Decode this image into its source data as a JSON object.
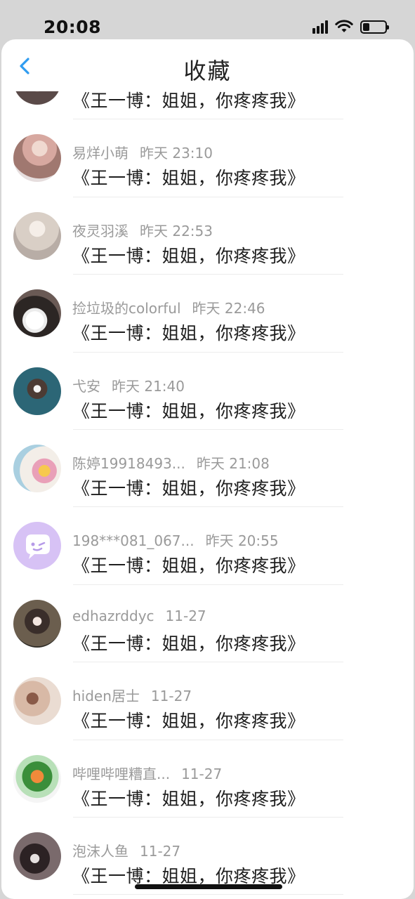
{
  "status_bar": {
    "time": "20:08"
  },
  "header": {
    "title": "收藏",
    "back_icon": "chevron-left-icon"
  },
  "colors": {
    "accent": "#2f9cf0",
    "text_primary": "#1f1f1f",
    "text_secondary": "#9a9a9a"
  },
  "items": [
    {
      "name": "",
      "time": "",
      "message": "《王一博：姐姐，你疼疼我》",
      "avatar": "avatar-photo"
    },
    {
      "name": "易烊小萌",
      "time": "昨天 23:10",
      "message": "《王一博：姐姐，你疼疼我》",
      "avatar": "avatar-photo"
    },
    {
      "name": "夜灵羽溪",
      "time": "昨天 22:53",
      "message": "《王一博：姐姐，你疼疼我》",
      "avatar": "avatar-photo"
    },
    {
      "name": "捡垃圾的colorful",
      "time": "昨天 22:46",
      "message": "《王一博：姐姐，你疼疼我》",
      "avatar": "avatar-photo"
    },
    {
      "name": "弋安",
      "time": "昨天 21:40",
      "message": "《王一博：姐姐，你疼疼我》",
      "avatar": "avatar-photo"
    },
    {
      "name": "陈婷19918493...",
      "time": "昨天 21:08",
      "message": "《王一博：姐姐，你疼疼我》",
      "avatar": "avatar-photo"
    },
    {
      "name": "198***081_067...",
      "time": "昨天 20:55",
      "message": "《王一博：姐姐，你疼疼我》",
      "avatar": "chat-bubble-icon"
    },
    {
      "name": "edhazrddyc",
      "time": "11-27",
      "message": "《王一博：姐姐，你疼疼我》",
      "avatar": "avatar-photo"
    },
    {
      "name": "hiden居士",
      "time": "11-27",
      "message": "《王一博：姐姐，你疼疼我》",
      "avatar": "avatar-photo"
    },
    {
      "name": "哔哩哔哩糟直...",
      "time": "11-27",
      "message": "《王一博：姐姐，你疼疼我》",
      "avatar": "avatar-photo"
    },
    {
      "name": "泡沫人鱼",
      "time": "11-27",
      "message": "《王一博：姐姐，你疼疼我》",
      "avatar": "avatar-photo"
    }
  ]
}
